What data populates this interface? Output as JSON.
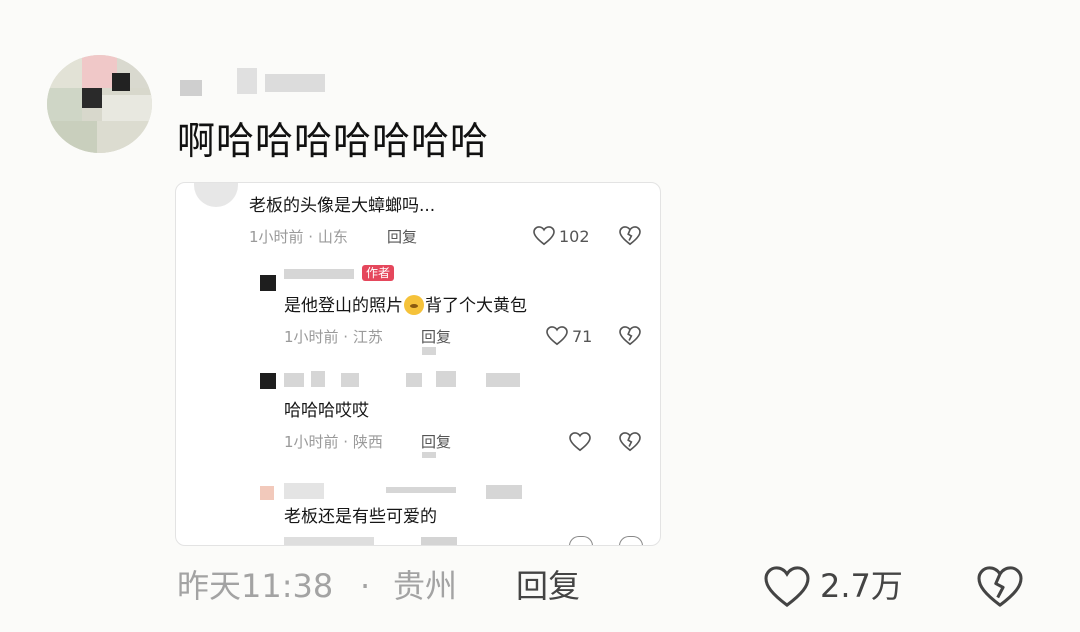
{
  "comment": {
    "text": "啊哈哈哈哈哈哈哈",
    "time": "昨天11:38",
    "separator": "·",
    "location": "贵州",
    "reply_label": "回复",
    "likes": "2.7万"
  },
  "quoted_screenshot": {
    "top_comment": {
      "text": "老板的头像是大蟑螂吗...",
      "time_location": "1小时前 · 山东",
      "reply_label": "回复",
      "likes": "102"
    },
    "replies": [
      {
        "author_tag": "作者",
        "text_before": "是他登山的照片",
        "emoji": "crying-emoji",
        "text_after": "背了个大黄包",
        "time_location": "1小时前 · 江苏",
        "reply_label": "回复",
        "likes": "71"
      },
      {
        "text": "哈哈哈哎哎",
        "time_location": "1小时前 · 陕西",
        "reply_label": "回复"
      },
      {
        "text": "老板还是有些可爱的"
      }
    ]
  },
  "colors": {
    "background": "#fbfbf9",
    "meta_gray": "#a3a3a3",
    "author_tag": "#e5475c"
  }
}
